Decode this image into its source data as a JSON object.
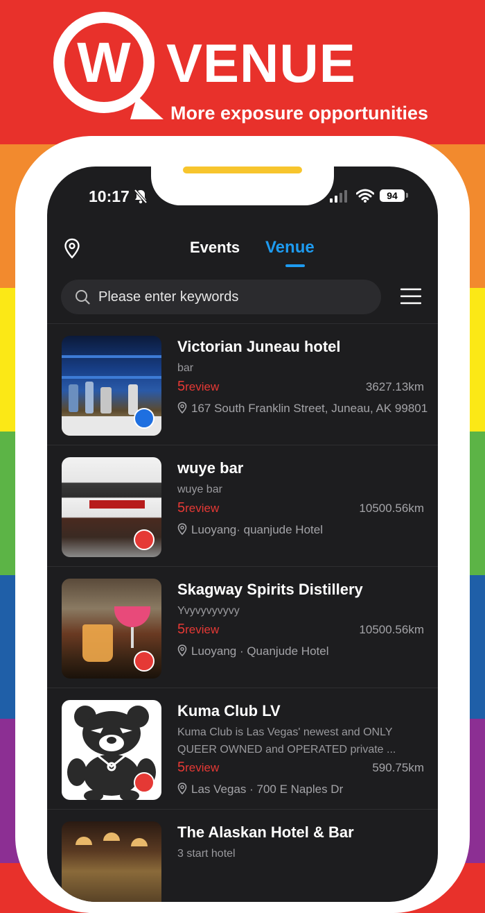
{
  "banner": {
    "title": "VENUE",
    "subtitle": "More exposure opportunities"
  },
  "status_bar": {
    "time": "10:17",
    "battery": "94"
  },
  "tabs": {
    "events": "Events",
    "venue": "Venue",
    "active": "venue"
  },
  "search": {
    "placeholder": "Please enter keywords"
  },
  "venues": [
    {
      "name": "Victorian Juneau hotel",
      "description": "bar",
      "review_count": "5",
      "review_label": "review",
      "distance": "3627.13km",
      "address": "167 South Franklin Street, Juneau, AK 99801"
    },
    {
      "name": "wuye bar",
      "description": "wuye bar",
      "review_count": "5",
      "review_label": "review",
      "distance": "10500.56km",
      "address": "Luoyang· quanjude Hotel"
    },
    {
      "name": "Skagway Spirits Distillery",
      "description": "Yvyvyvyvyvy",
      "review_count": "5",
      "review_label": "review",
      "distance": "10500.56km",
      "address": "Luoyang · Quanjude Hotel"
    },
    {
      "name": "Kuma Club LV",
      "description": "Kuma Club is Las Vegas' newest and ONLY QUEER OWNED and OPERATED private ...",
      "review_count": "5",
      "review_label": "review",
      "distance": "590.75km",
      "address": "Las Vegas · 700 E Naples Dr"
    },
    {
      "name": "The Alaskan Hotel & Bar",
      "description": "3 start hotel"
    }
  ],
  "colors": {
    "accent_blue": "#1e9bf0",
    "review_red": "#e53935",
    "background": "#1d1d1f"
  }
}
